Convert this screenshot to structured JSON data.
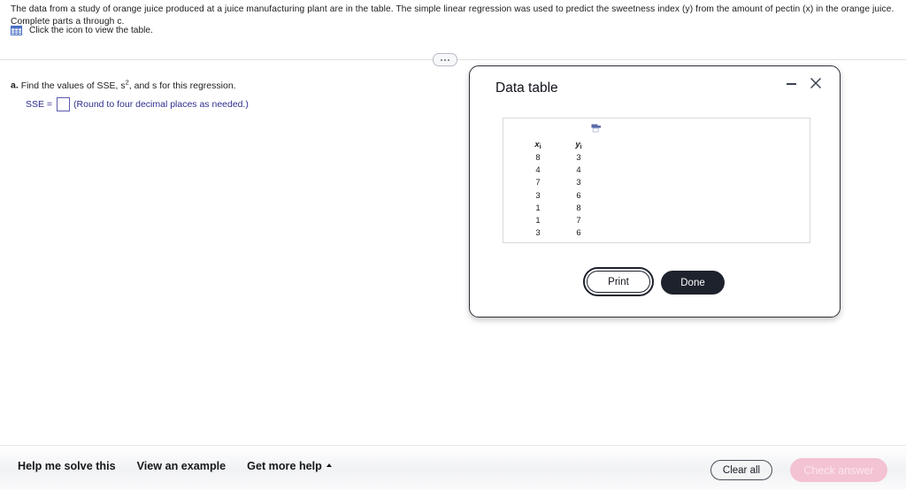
{
  "problem": {
    "statement": "The data from a study of orange juice produced at a juice manufacturing plant are in the table. The simple linear regression was used to predict the sweetness index (y) from the amount of pectin (x) in the orange juice. Complete parts a through c.",
    "icon_hint": "Click the icon to view the table.",
    "table_icon": "table-icon"
  },
  "divider": {
    "pill_label": "..."
  },
  "part_a": {
    "label": "a.",
    "text_before": "Find the values of SSE, s",
    "superscript": "2",
    "text_after": ", and s for this regression.",
    "sse_label": "SSE =",
    "sse_value": "",
    "sse_hint": "(Round to four decimal places as needed.)"
  },
  "dialog": {
    "title": "Data table",
    "minimize_icon": "minimize-icon",
    "close_icon": "close-icon",
    "panel_icon": "print-preview-icon",
    "table": {
      "headers": [
        "x",
        "y"
      ],
      "header_subscript": "i",
      "rows": [
        [
          "8",
          "3"
        ],
        [
          "4",
          "4"
        ],
        [
          "7",
          "3"
        ],
        [
          "3",
          "6"
        ],
        [
          "1",
          "8"
        ],
        [
          "1",
          "7"
        ],
        [
          "3",
          "6"
        ]
      ]
    },
    "print_label": "Print",
    "done_label": "Done"
  },
  "bottom_bar": {
    "help_me_solve": "Help me solve this",
    "view_example": "View an example",
    "get_more_help": "Get more help",
    "clear_all": "Clear all",
    "check_answer": "Check answer"
  },
  "chart_data": {
    "type": "table",
    "title": "Data table",
    "columns": [
      "x_i",
      "y_i"
    ],
    "x": [
      8,
      4,
      7,
      3,
      1,
      1,
      3
    ],
    "y": [
      3,
      4,
      3,
      6,
      8,
      7,
      6
    ]
  },
  "colors": {
    "accent_dark": "#1d222c",
    "link_blue": "#2f2f8f",
    "icon_blue": "#4a6fc4",
    "check_answer_pink": "#f3c2d3"
  }
}
